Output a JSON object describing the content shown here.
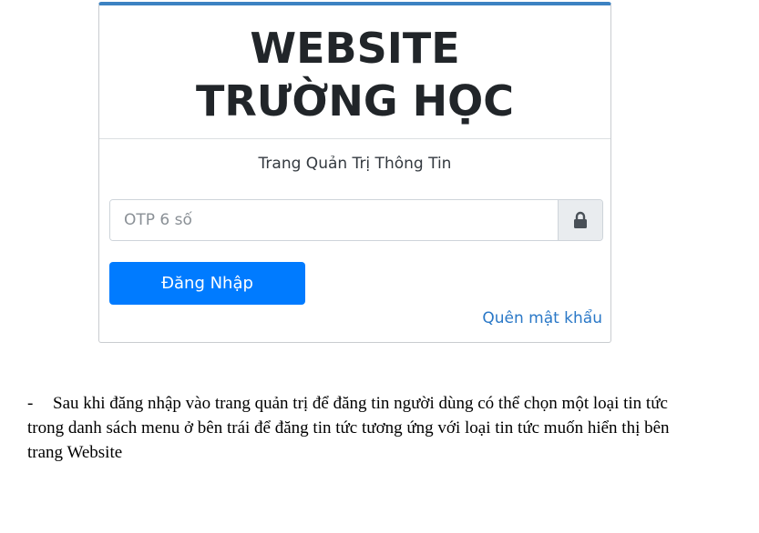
{
  "login_card": {
    "title_line1": "WEBSITE",
    "title_line2": "TRƯỜNG HỌC",
    "subtitle": "Trang Quản Trị Thông Tin",
    "otp_placeholder": "OTP 6 số",
    "otp_value": "",
    "lock_icon": "lock-icon",
    "login_label": "Đăng Nhập",
    "forgot_label": "Quên mật khẩu",
    "accent_color": "#007bff",
    "top_border_color": "#3c82c2"
  },
  "document": {
    "bullet": "-",
    "paragraph": "Sau khi đăng nhập vào trang quản trị để đăng tin người dùng có thể chọn một loại tin tức trong danh sách menu ở bên trái để đăng tin tức tương ứng với loại tin tức muốn hiển thị bên trang Website"
  }
}
